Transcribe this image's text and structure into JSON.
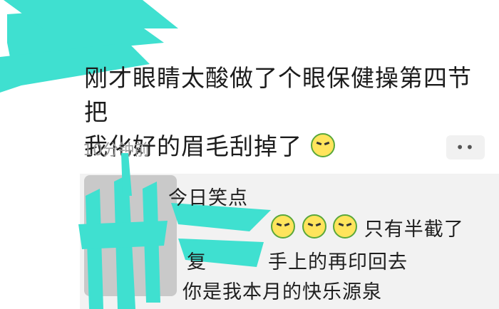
{
  "post": {
    "text_line1": "刚才眼睛太酸做了个眼保健操第四节把",
    "text_line2": "我化好的眉毛刮掉了",
    "emoji": "crying-angry-emoji",
    "timestamp": "10分钟前",
    "more_label": "••"
  },
  "comments": {
    "line1": "今日笑点",
    "line2": "只有半截了",
    "line3_prefix": "复",
    "line3_suffix": "手上的再印回去",
    "line4": "你是我本月的快乐源泉"
  },
  "colors": {
    "scribble": "#3fe0d0",
    "emoji_face": "#ffe45c",
    "emoji_border": "#5aa83b",
    "timestamp": "#9a9a9a",
    "comment_bg": "#f2f2f2"
  }
}
